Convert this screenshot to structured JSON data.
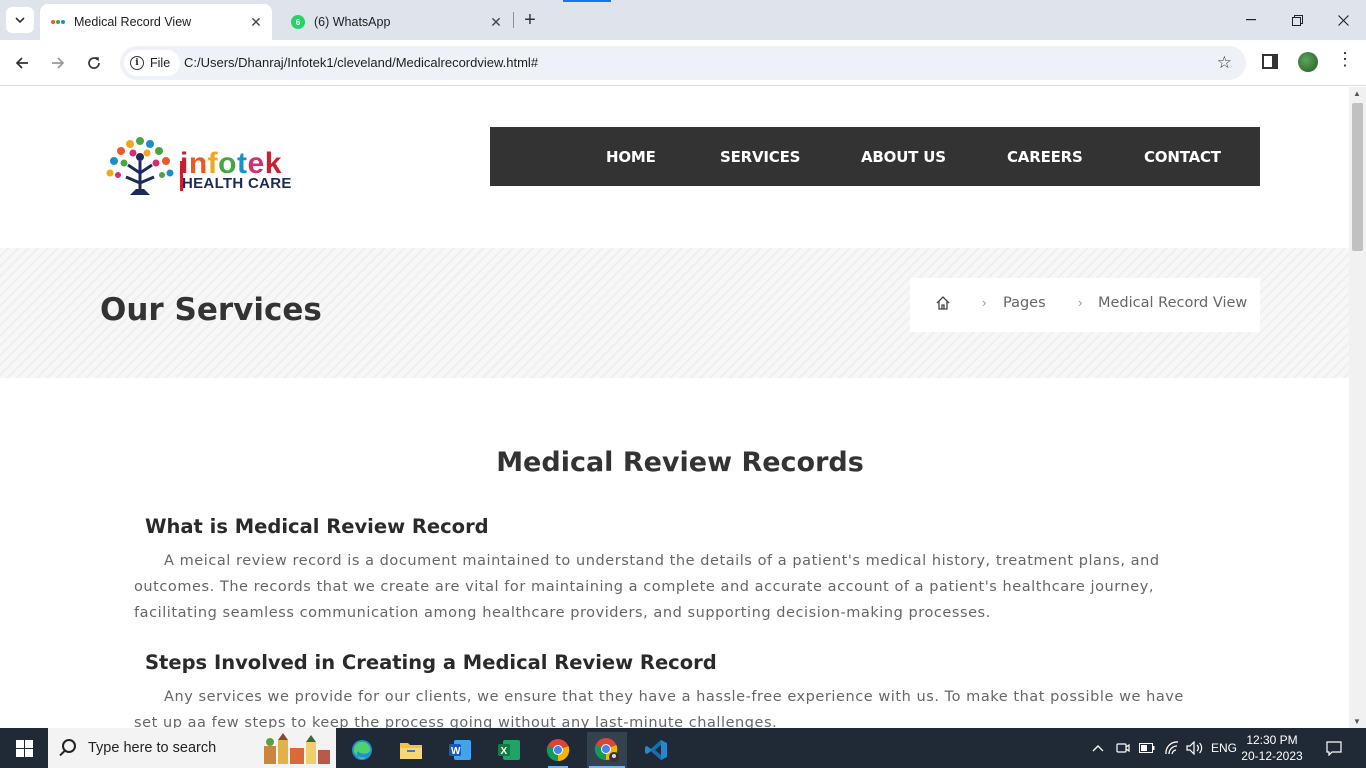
{
  "browser": {
    "tabs": [
      {
        "title": "Medical Record View",
        "active": true
      },
      {
        "title": "(6) WhatsApp",
        "active": false,
        "badge": "6"
      }
    ],
    "file_label": "File",
    "url": "C:/Users/Dhanraj/Infotek1/cleveland/Medicalrecordview.html#"
  },
  "site": {
    "logo": {
      "word": "infotek",
      "sub": "HEALTH CARE"
    },
    "nav": [
      "HOME",
      "SERVICES",
      "ABOUT US",
      "CAREERS",
      "CONTACT"
    ],
    "banner": {
      "title": "Our Services",
      "breadcrumb": [
        "Pages",
        "Medical Record View"
      ]
    },
    "content": {
      "title": "Medical Review Records",
      "sections": [
        {
          "heading": "What is Medical Review Record",
          "text": "A meical review record is a document maintained to understand the details of a patient's medical history, treatment plans, and outcomes. The records that we create are vital for maintaining a complete and accurate account of a patient's healthcare journey, facilitating seamless communication among healthcare providers, and supporting decision-making processes."
        },
        {
          "heading": "Steps Involved in Creating a Medical Review Record",
          "text": "Any services we provide for our clients, we ensure that they have a hassle-free experience with us. To make that possible we have set up aa few steps to keep the process going without any last-minute challenges."
        }
      ]
    }
  },
  "taskbar": {
    "search_placeholder": "Type here to search",
    "apps": [
      "edge-icon",
      "file-explorer-icon",
      "word-icon",
      "excel-icon",
      "chrome-icon",
      "chrome-profile-icon",
      "vscode-icon"
    ],
    "language": "ENG",
    "time": "12:30 PM",
    "date": "20-12-2023"
  },
  "colors": {
    "nav_bg": "#333333",
    "heading": "#333333",
    "body_text": "#666666",
    "logo_i": "#c8202e",
    "logo_n": "#e85a25",
    "logo_f": "#f3a51b",
    "logo_o": "#4ba443",
    "logo_t": "#1a8fc9",
    "logo_e": "#d62d6f",
    "logo_k": "#c8202e"
  }
}
